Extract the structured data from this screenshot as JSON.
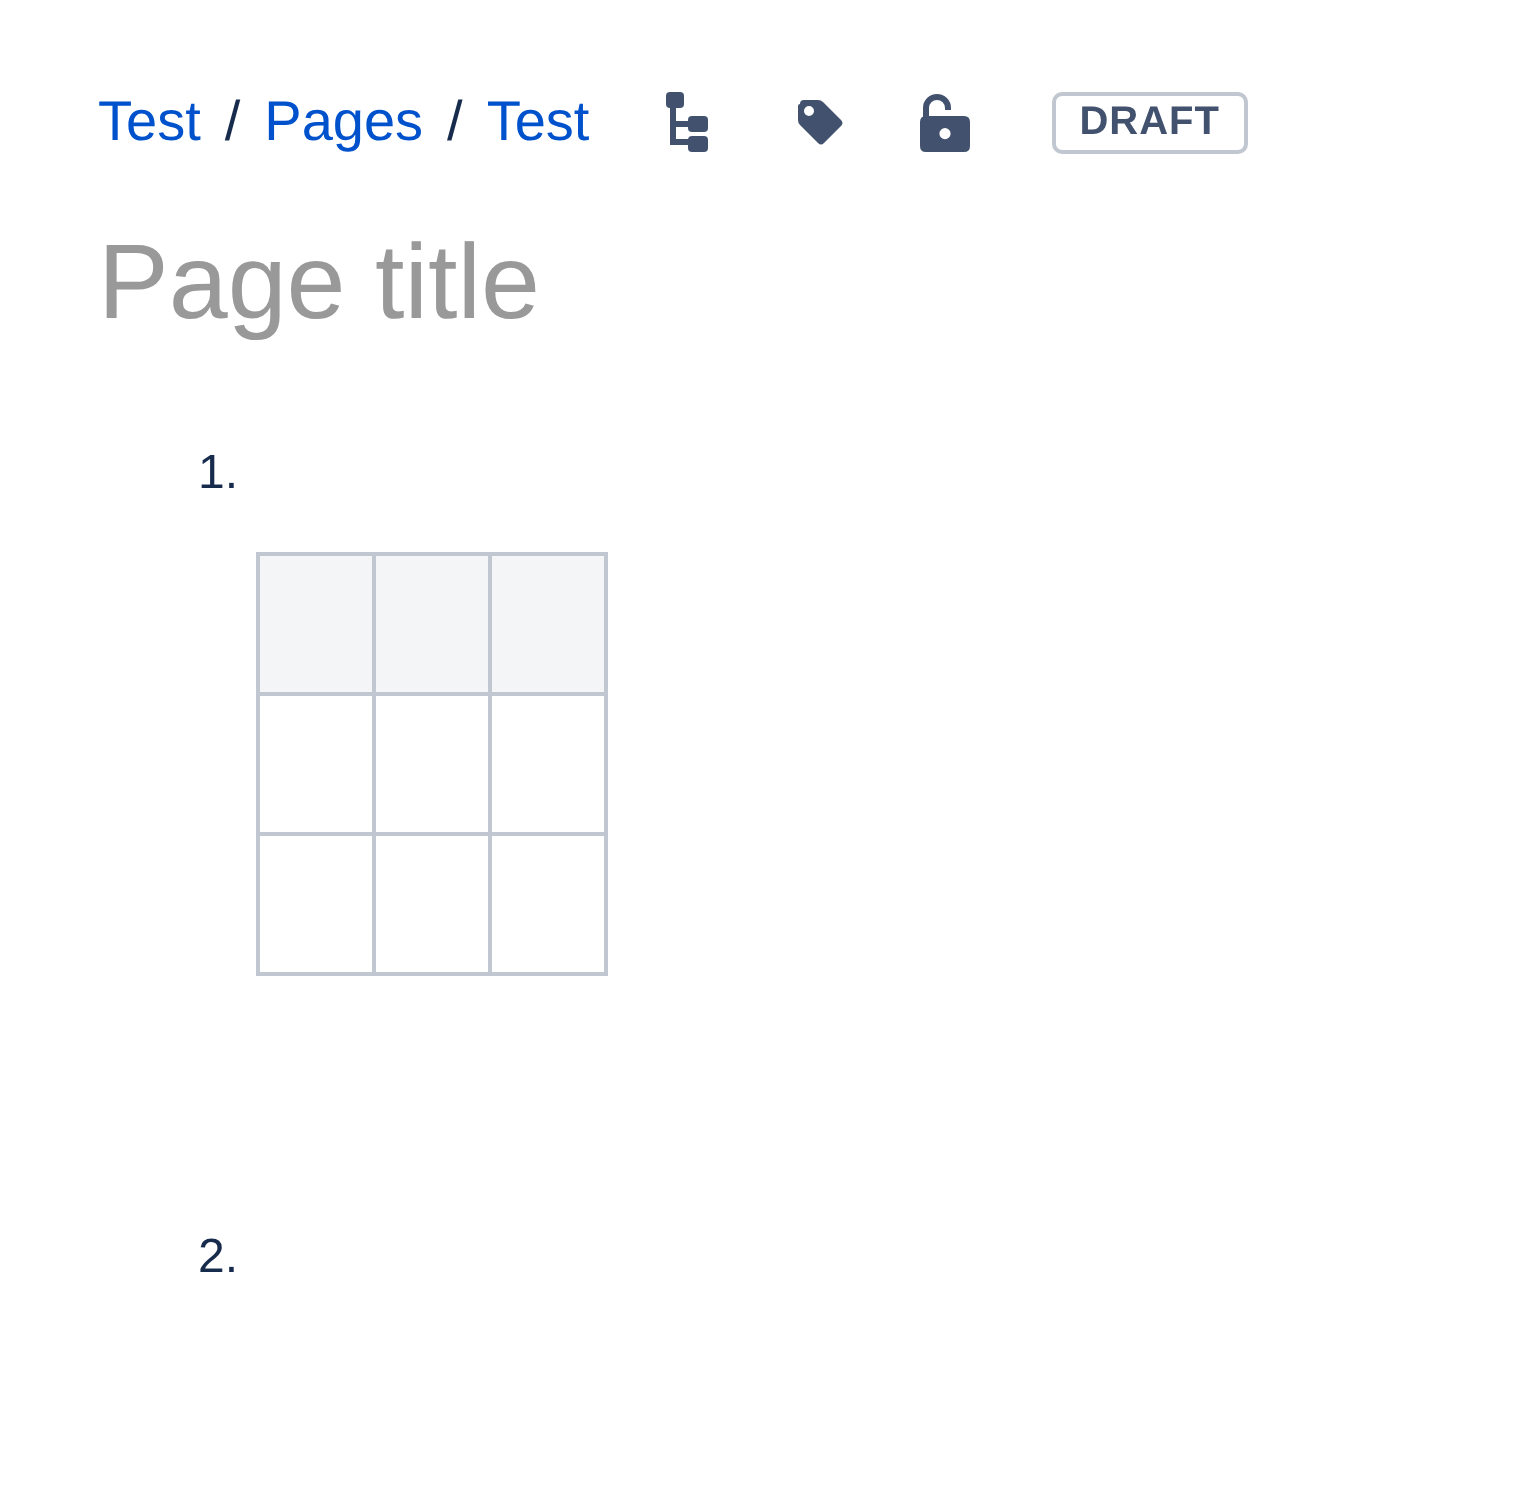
{
  "breadcrumb": {
    "items": [
      {
        "label": "Test"
      },
      {
        "label": "Pages"
      },
      {
        "label": "Test"
      }
    ],
    "separators": [
      "/",
      "/"
    ]
  },
  "status_badge": {
    "label": "DRAFT"
  },
  "title_field": {
    "placeholder": "Page title"
  },
  "list": {
    "items": [
      {
        "marker": "1.",
        "table": {
          "rows": [
            {
              "kind": "header",
              "cells": [
                {},
                {},
                {}
              ]
            },
            {
              "kind": "body",
              "cells": [
                {},
                {},
                {}
              ]
            },
            {
              "kind": "body",
              "cells": [
                {},
                {},
                {}
              ]
            }
          ]
        }
      },
      {
        "marker": "2."
      }
    ]
  }
}
